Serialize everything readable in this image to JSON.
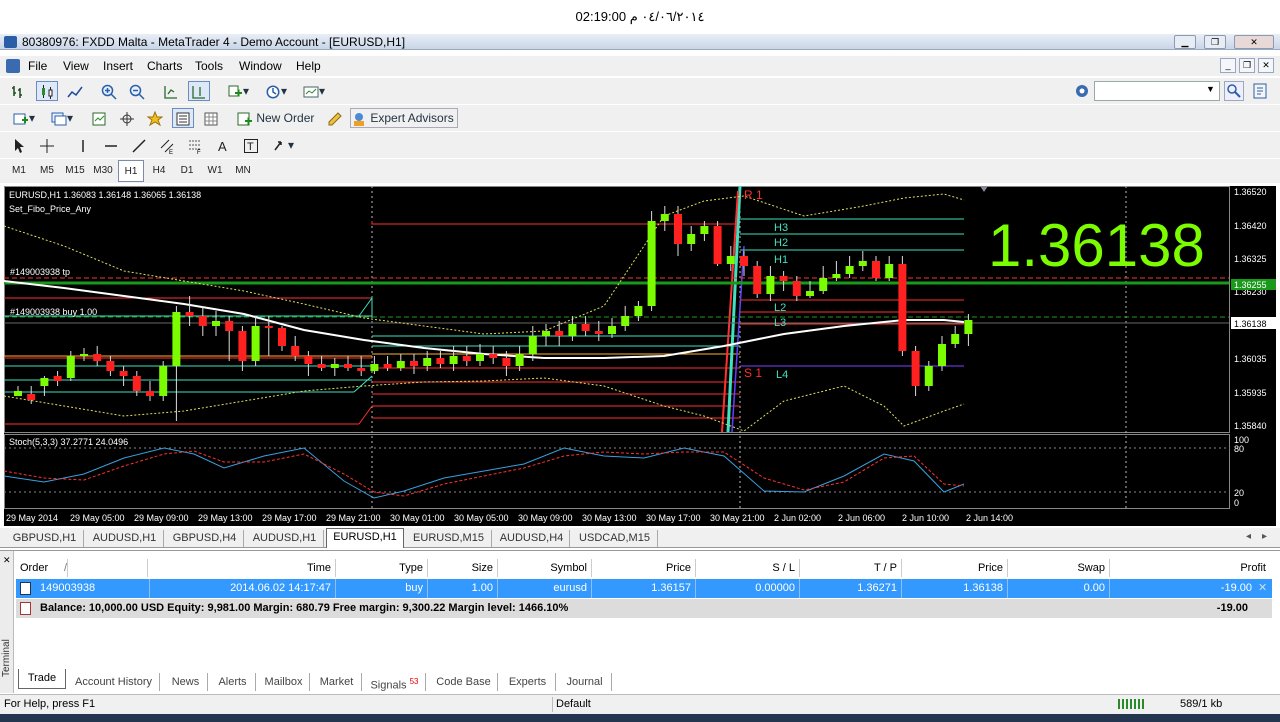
{
  "clock": "02:19:00 ٠٤/٠٦/٢٠١٤ م",
  "window": {
    "title": "80380976: FXDD Malta - MetaTrader 4 - Demo Account - [EURUSD,H1]"
  },
  "menu": [
    "File",
    "View",
    "Insert",
    "Charts",
    "Tools",
    "Window",
    "Help"
  ],
  "toolbar2": {
    "new_order": "New Order",
    "expert_advisors": "Expert Advisors"
  },
  "timeframes": [
    "M1",
    "M5",
    "M15",
    "M30",
    "H1",
    "H4",
    "D1",
    "W1",
    "MN"
  ],
  "selected_timeframe": "H1",
  "chart": {
    "header": "EURUSD,H1  1.36083 1.36148 1.36065 1.36138",
    "indicator": "Set_Fibo_Price_Any",
    "big_price": "1.36138",
    "order_tp_label": "#149003938 tp",
    "order_buy_label": "#149003938 buy 1.00",
    "level_labels": [
      "R 1",
      "H3",
      "H2",
      "H1",
      "L2",
      "L3",
      "S 1",
      "L4"
    ],
    "price_scale": [
      "1.36520",
      "1.36420",
      "1.36325",
      "1.36230",
      "1.36138",
      "1.36035",
      "1.35935",
      "1.35840"
    ],
    "tp_price_tag": "1.36255",
    "stoch_label": "Stoch(5,3,3) 37.2771 24.0496",
    "stoch_scale": [
      "100",
      "80",
      "20",
      "0"
    ],
    "time_axis": [
      "29 May 2014",
      "29 May 05:00",
      "29 May 09:00",
      "29 May 13:00",
      "29 May 17:00",
      "29 May 21:00",
      "30 May 01:00",
      "30 May 05:00",
      "30 May 09:00",
      "30 May 13:00",
      "30 May 17:00",
      "30 May 21:00",
      "2 Jun 02:00",
      "2 Jun 06:00",
      "2 Jun 10:00",
      "2 Jun 14:00"
    ],
    "colors": {
      "bull": "#7cfc00",
      "bear": "#ff2020",
      "big_price": "#7cfc00"
    }
  },
  "sheets": [
    "GBPUSD,H1",
    "AUDUSD,H1",
    "GBPUSD,H4",
    "AUDUSD,H1",
    "EURUSD,H1",
    "EURUSD,M15",
    "AUDUSD,H4",
    "USDCAD,M15"
  ],
  "selected_sheet": "EURUSD,H1",
  "terminal": {
    "side_label": "Terminal",
    "columns": [
      "Order",
      "/",
      "Time",
      "Type",
      "Size",
      "Symbol",
      "Price",
      "S / L",
      "T / P",
      "Price",
      "Swap",
      "Profit"
    ],
    "order": {
      "order": "149003938",
      "time": "2014.06.02 14:17:47",
      "type": "buy",
      "size": "1.00",
      "symbol": "eurusd",
      "price": "1.36157",
      "sl": "0.00000",
      "tp": "1.36271",
      "cur_price": "1.36138",
      "swap": "0.00",
      "profit": "-19.00"
    },
    "balance_line": "Balance: 10,000.00 USD  Equity: 9,981.00  Margin: 680.79  Free margin: 9,300.22  Margin level: 1466.10%",
    "balance_profit": "-19.00",
    "tabs": [
      "Trade",
      "Account History",
      "News",
      "Alerts",
      "Mailbox",
      "Market",
      "Signals",
      "Code Base",
      "Experts",
      "Journal"
    ],
    "signals_badge": "53",
    "selected_tab": "Trade"
  },
  "status": {
    "help": "For Help, press F1",
    "profile": "Default",
    "traffic": "589/1 kb"
  }
}
